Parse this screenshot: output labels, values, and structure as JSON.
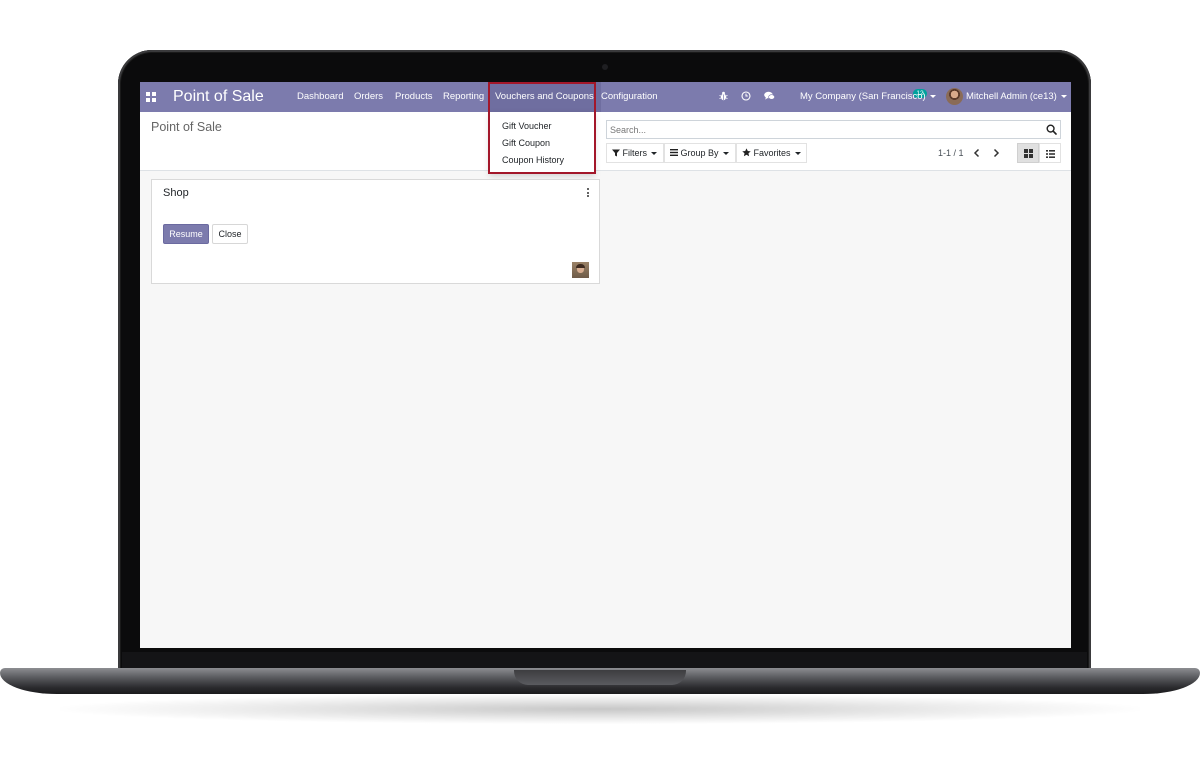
{
  "app": {
    "title": "Point of Sale",
    "menu": [
      "Dashboard",
      "Orders",
      "Products",
      "Reporting",
      "Vouchers and Coupons",
      "Configuration"
    ],
    "open_menu": "Vouchers and Coupons",
    "dropdown_items": [
      "Gift Voucher",
      "Gift Coupon",
      "Coupon History"
    ]
  },
  "systray": {
    "icons": [
      "bug-icon",
      "clock-icon",
      "chat-icon"
    ],
    "message_count": "12",
    "company": "My Company (San Francisco)",
    "user": "Mitchell Admin (ce13)"
  },
  "control_panel": {
    "breadcrumb": "Point of Sale",
    "search_placeholder": "Search...",
    "filters_label": "Filters",
    "group_by_label": "Group By",
    "favorites_label": "Favorites",
    "pager": "1-1 / 1",
    "views": [
      "kanban",
      "list"
    ],
    "active_view": "kanban"
  },
  "session_card": {
    "name": "Shop",
    "primary_button": "Resume",
    "secondary_button": "Close"
  },
  "colors": {
    "navbar": "#7c7bad",
    "highlight": "#a3172a",
    "badge": "#00a09d"
  }
}
